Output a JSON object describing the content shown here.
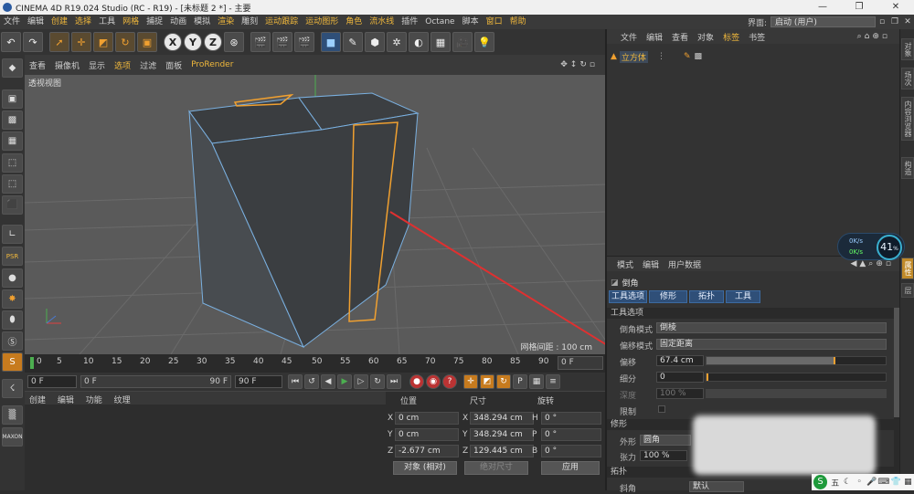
{
  "window": {
    "title": "CINEMA 4D R19.024 Studio (RC - R19) - [未标题 2 *] - 主要",
    "minimize": "—",
    "maximize": "❐",
    "close": "✕"
  },
  "menubar": {
    "items": [
      "文件",
      "编辑",
      "创建",
      "选择",
      "工具",
      "网格",
      "捕捉",
      "动画",
      "模拟",
      "渲染",
      "雕刻",
      "运动跟踪",
      "运动图形",
      "角色",
      "流水线",
      "插件",
      "Octane",
      "脚本",
      "窗口",
      "帮助"
    ],
    "layout_label": "界面:",
    "layout_value": "启动 (用户)"
  },
  "viewport": {
    "menu": [
      "查看",
      "摄像机",
      "显示",
      "选项",
      "过滤",
      "面板",
      "ProRender"
    ],
    "label": "透视视图",
    "grid_spacing": "网格间距 : 100 cm"
  },
  "timeline": {
    "ticks": [
      "0",
      "5",
      "10",
      "15",
      "20",
      "25",
      "30",
      "35",
      "40",
      "45",
      "50",
      "55",
      "60",
      "65",
      "70",
      "75",
      "80",
      "85",
      "90"
    ],
    "current_frame": "0 F"
  },
  "playbar": {
    "start": "0 F",
    "preview_start": "0 F",
    "preview_end": "90 F",
    "end": "90 F"
  },
  "material": {
    "menu": [
      "创建",
      "编辑",
      "功能",
      "纹理"
    ]
  },
  "coords": {
    "headers": [
      "位置",
      "尺寸",
      "旋转"
    ],
    "rows": [
      {
        "pos_label": "X",
        "pos": "0 cm",
        "size_label": "X",
        "size": "348.294 cm",
        "rot_label": "H",
        "rot": "0 °"
      },
      {
        "pos_label": "Y",
        "pos": "0 cm",
        "size_label": "Y",
        "size": "348.294 cm",
        "rot_label": "P",
        "rot": "0 °"
      },
      {
        "pos_label": "Z",
        "pos": "-2.677 cm",
        "size_label": "Z",
        "size": "129.445 cm",
        "rot_label": "B",
        "rot": "0 °"
      }
    ],
    "mode": "对象 (相对)",
    "size_mode": "绝对尺寸",
    "apply": "应用"
  },
  "objects": {
    "menu": [
      "文件",
      "编辑",
      "查看",
      "对象",
      "标签",
      "书签"
    ],
    "items": [
      {
        "name": "立方体"
      }
    ]
  },
  "right_tabs": [
    "对象",
    "场次",
    "内容浏览器",
    "构造",
    "属性",
    "层"
  ],
  "attributes": {
    "menu": [
      "模式",
      "编辑",
      "用户数据"
    ],
    "tool_name": "倒角",
    "tabs": [
      "工具选项",
      "修形",
      "拓扑",
      "工具"
    ],
    "section_tool": "工具选项",
    "bevel_mode_label": "倒角模式",
    "bevel_mode": "倒棱",
    "offset_mode_label": "偏移模式",
    "offset_mode": "固定距离",
    "offset_label": "偏移",
    "offset_value": "67.4 cm",
    "offset_level": 0.72,
    "subdivision_label": "细分",
    "subdivision_value": "0",
    "depth_label": "深度",
    "depth_value": "100 %",
    "limit_label": "限制",
    "section_shape": "修形",
    "shape_label": "外形",
    "shape_value": "圆角",
    "tension_label": "张力",
    "tension_value": "100 %",
    "section_topo": "拓扑",
    "corner_label": "斜角",
    "corner_value": "默认"
  },
  "perf": {
    "percent": "41",
    "percent_unit": "%",
    "up": "0K/s",
    "down": "0K/s"
  },
  "systray": {
    "logo": "S",
    "label": "五"
  },
  "colors": {
    "accent": "#f0b83c",
    "selection": "#f0a030",
    "viewport_bg": "#5a5a5a",
    "arrow": "#e03030"
  }
}
